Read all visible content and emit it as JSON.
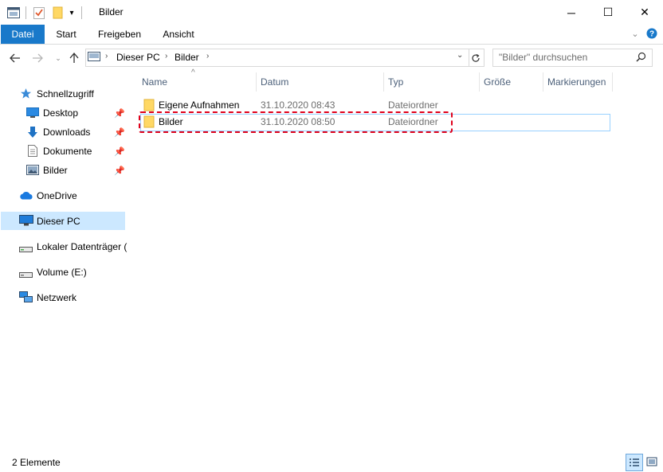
{
  "window": {
    "title": "Bilder",
    "minimize_glyph": "─",
    "maximize_glyph": "☐",
    "close_glyph": "✕"
  },
  "ribbon": {
    "tabs": [
      "Datei",
      "Start",
      "Freigeben",
      "Ansicht"
    ],
    "active_color": "#1979ca"
  },
  "address": {
    "path": [
      "Dieser PC",
      "Bilder"
    ],
    "search_placeholder": "\"Bilder\" durchsuchen"
  },
  "nav": {
    "quick_access": "Schnellzugriff",
    "quick_items": [
      {
        "label": "Desktop",
        "icon": "desktop-icon"
      },
      {
        "label": "Downloads",
        "icon": "download-icon"
      },
      {
        "label": "Dokumente",
        "icon": "document-icon"
      },
      {
        "label": "Bilder",
        "icon": "pictures-icon"
      }
    ],
    "onedrive": "OneDrive",
    "this_pc": "Dieser PC",
    "drives": [
      "Lokaler Datenträger (",
      "Volume (E:)"
    ],
    "network": "Netzwerk"
  },
  "columns": [
    "Name",
    "Datum",
    "Typ",
    "Größe",
    "Markierungen"
  ],
  "files": [
    {
      "name": "Eigene Aufnahmen",
      "date": "31.10.2020 08:43",
      "type": "Dateiordner"
    },
    {
      "name": "Bilder",
      "date": "31.10.2020 08:50",
      "type": "Dateiordner"
    }
  ],
  "status": {
    "count": "2 Elemente"
  },
  "colors": {
    "selection": "#cce8ff",
    "highlight_dash": "#e0001a",
    "folder": "#ffd864"
  }
}
